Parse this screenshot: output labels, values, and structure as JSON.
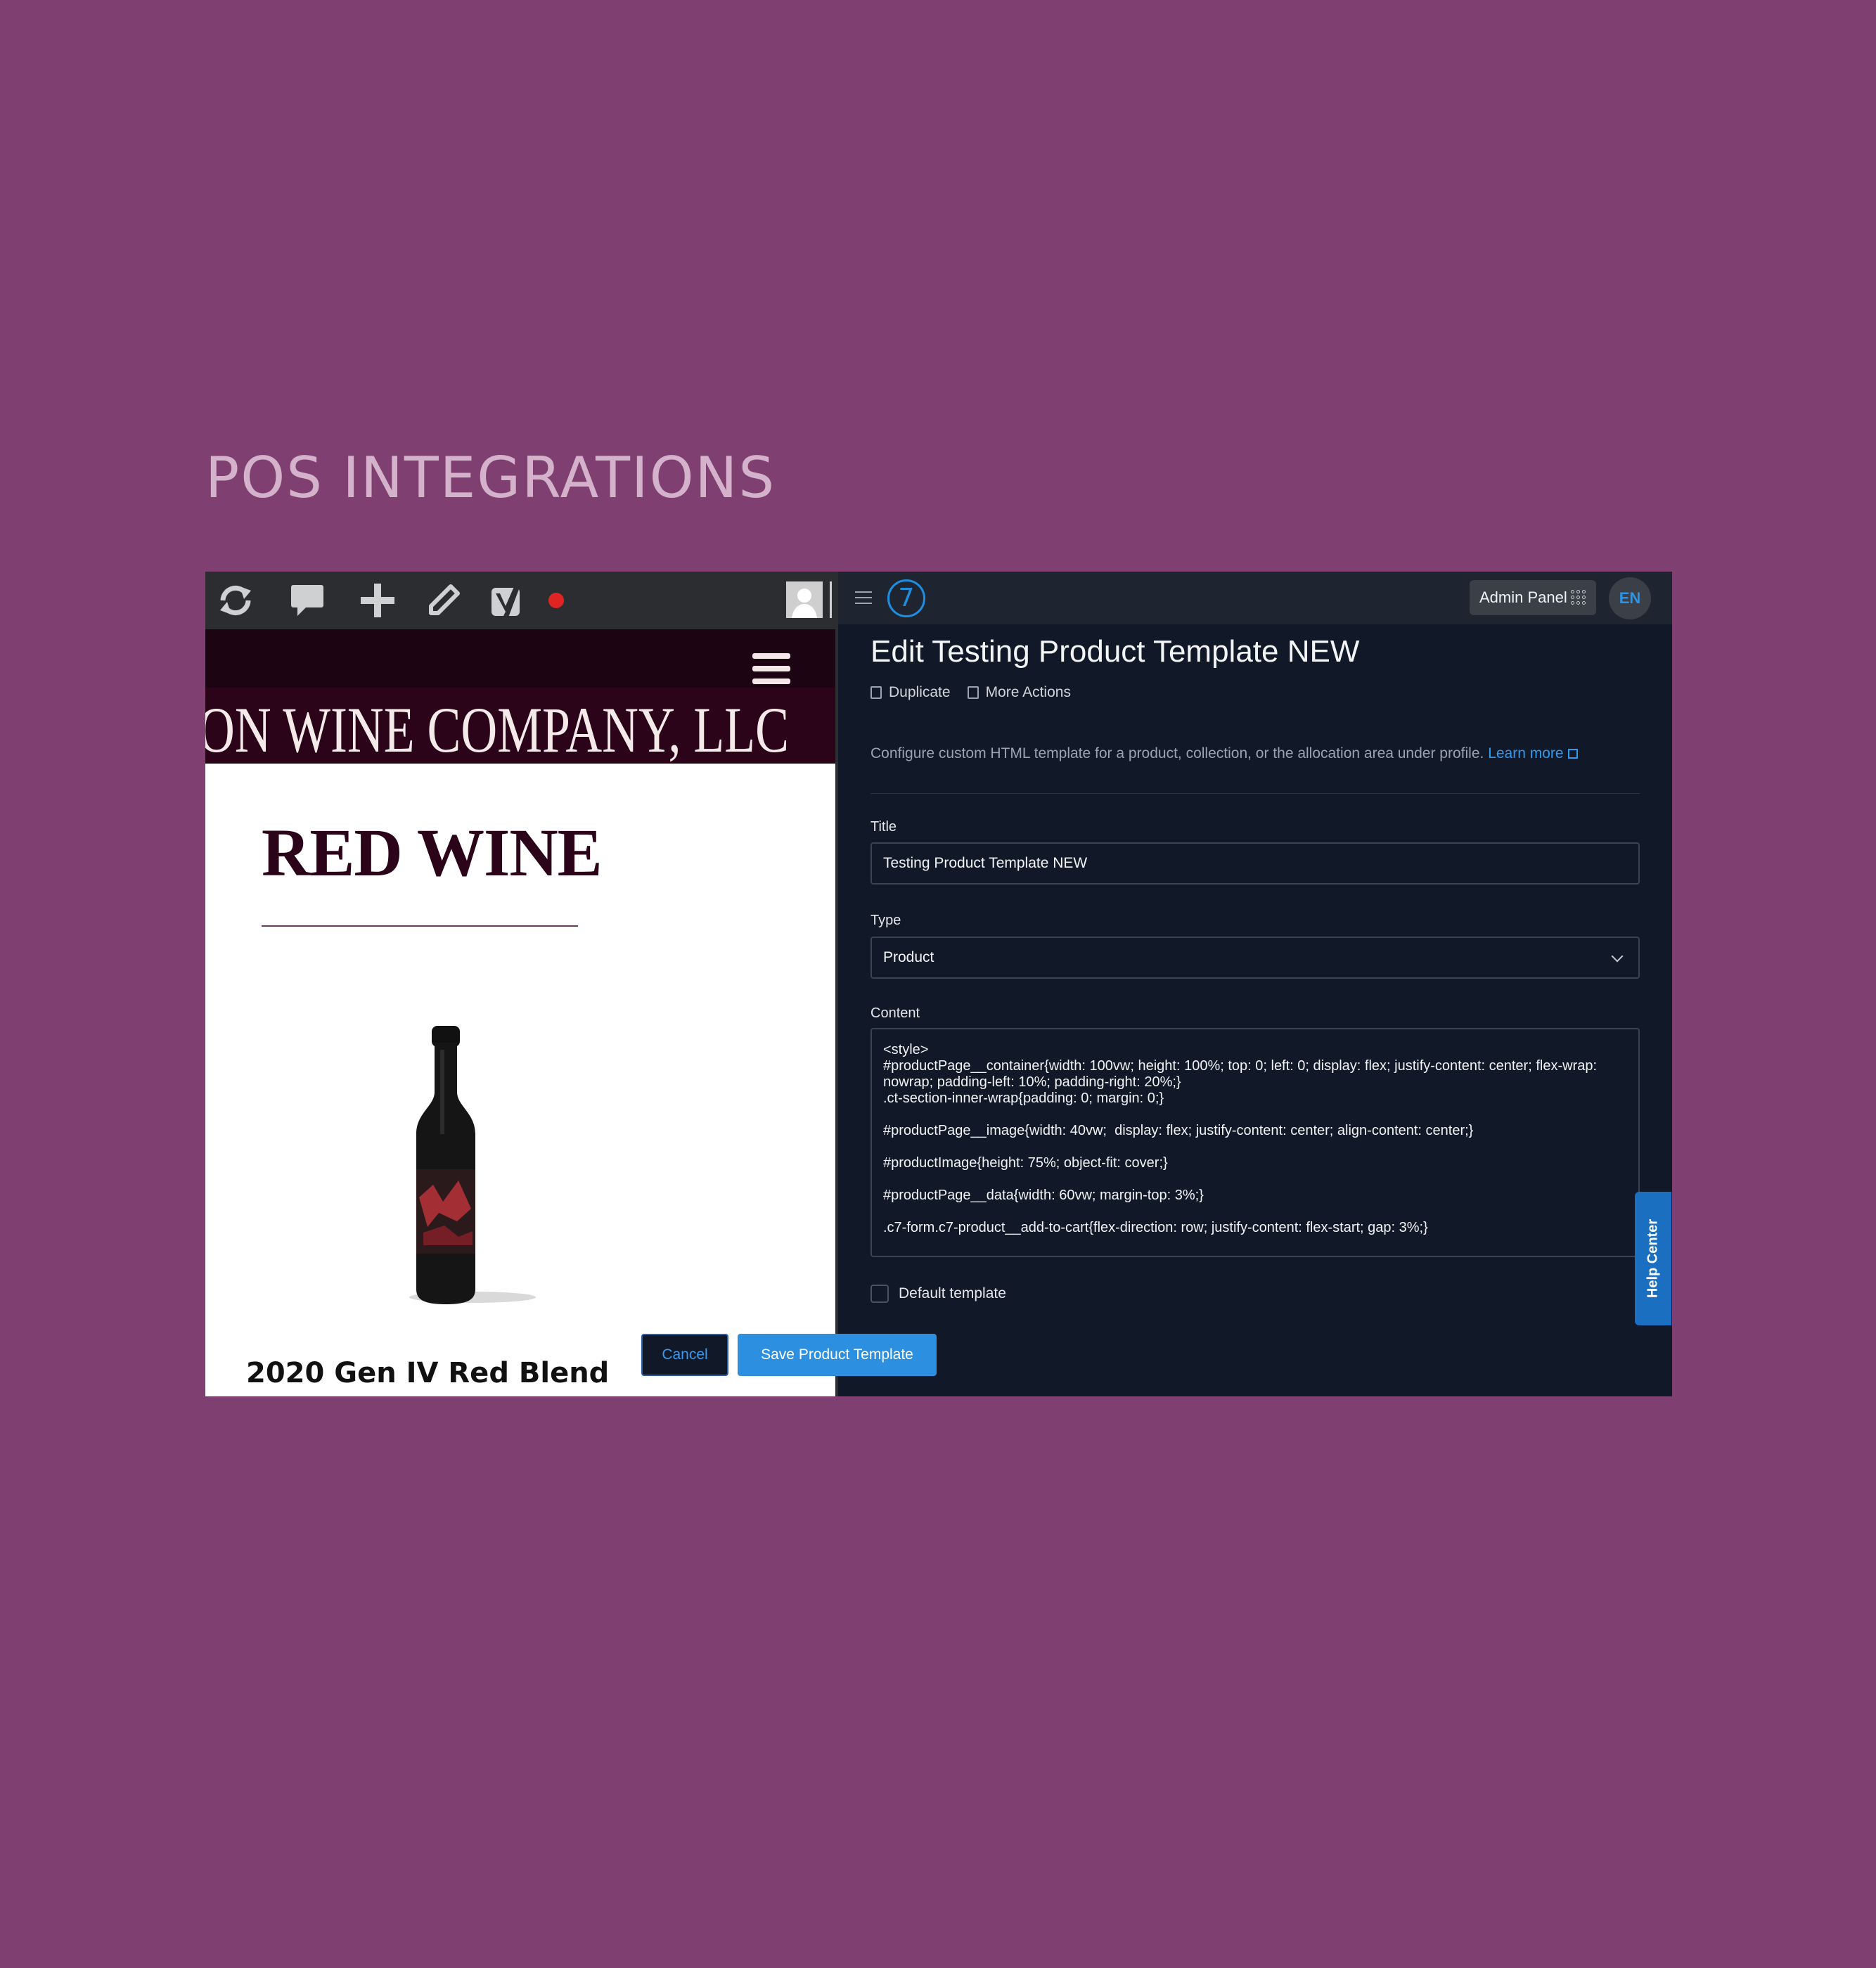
{
  "heading": "POS INTEGRATIONS",
  "colors": {
    "background": "#7f3f70",
    "site_header": "#2b0419",
    "admin_bg": "#111827",
    "accent": "#2d8fe0"
  },
  "website": {
    "toolbar_icons": [
      "refresh-icon",
      "comment-icon",
      "add-icon",
      "edit-icon",
      "yoast-icon",
      "record-dot-icon",
      "user-avatar"
    ],
    "banner_text": "ON WINE COMPANY, LLC",
    "category_title": "RED WINE",
    "product_name": "2020 Gen IV Red Blend"
  },
  "admin": {
    "admin_panel_label": "Admin Panel",
    "language": "EN",
    "logo_text": "7",
    "page_title": "Edit Testing Product Template NEW",
    "actions": {
      "duplicate": "Duplicate",
      "more_actions": "More Actions"
    },
    "description": "Configure custom HTML template for a product, collection, or the allocation area under profile.",
    "learn_more": "Learn more",
    "title_label": "Title",
    "title_value": "Testing Product Template NEW",
    "type_label": "Type",
    "type_value": "Product",
    "content_label": "Content",
    "content_lines": [
      "<style>",
      "#productPage__container{width: 100vw; height: 100%; top: 0; left: 0; display: flex; justify-content: center; flex-wrap: nowrap; padding-left: 10%; padding-right: 20%;}",
      "",
      ".ct-section-inner-wrap{padding: 0; margin: 0;}",
      "",
      "#productPage__image{width: 40vw;  display: flex; justify-content: center; align-content: center;}",
      "",
      "#productImage{height: 75%; object-fit: cover;}",
      "",
      "#productPage__data{width: 60vw; margin-top: 3%;}",
      "",
      ".c7-form.c7-product__add-to-cart{flex-direction: row; justify-content: flex-start; gap: 3%;}"
    ],
    "default_template_label": "Default template",
    "help_center": "Help Center",
    "cancel_label": "Cancel",
    "save_label": "Save Product Template"
  }
}
